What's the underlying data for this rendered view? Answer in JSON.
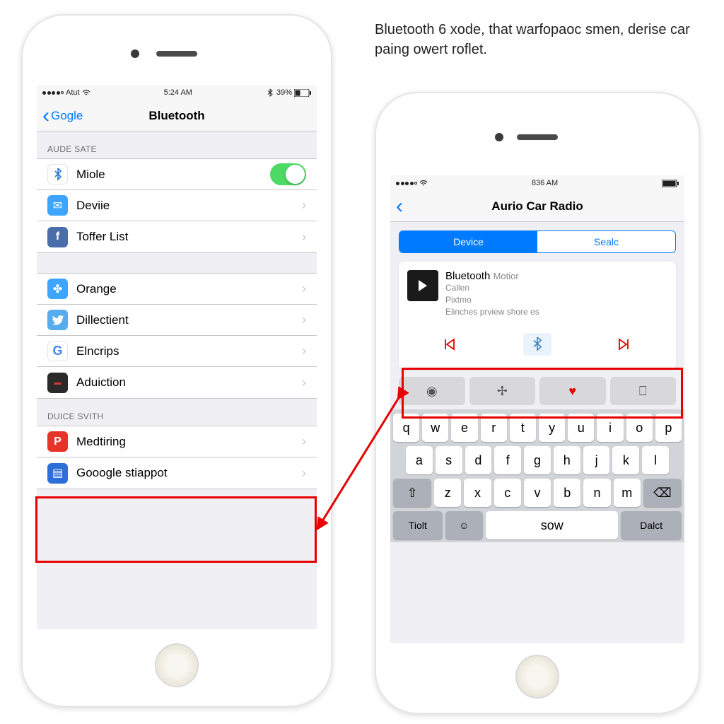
{
  "caption": "Bluetooth 6 xode, that warfopaoc smen, derise car paing owert roflet.",
  "phone_left": {
    "status": {
      "carrier": "Atut",
      "time": "5:24 AM",
      "battery_pct": "39%"
    },
    "nav": {
      "back": "Gogle",
      "title": "Bluetooth"
    },
    "section1_header": "AUDE SATE",
    "section1_items": [
      {
        "label": "Miole",
        "icon_name": "bluetooth-icon",
        "icon_bg": "#ffffff",
        "icon_color": "#2b7bd6",
        "toggle": true
      },
      {
        "label": "Deviie",
        "icon_name": "messages-icon",
        "icon_bg": "#3da5ff",
        "icon_color": "#fff"
      },
      {
        "label": "Toffer List",
        "icon_name": "social-icon",
        "icon_bg": "#4a6ea9",
        "icon_color": "#fff"
      }
    ],
    "section2_items": [
      {
        "label": "Orange",
        "icon_name": "flame-icon",
        "icon_bg": "#3da5ff",
        "icon_color": "#fff"
      },
      {
        "label": "Dillectient",
        "icon_name": "twitter-icon",
        "icon_bg": "#55acee",
        "icon_color": "#fff"
      },
      {
        "label": "Elncrips",
        "icon_name": "google-icon",
        "icon_bg": "#ffffff",
        "icon_color": "#333"
      },
      {
        "label": "Aduiction",
        "icon_name": "app-icon",
        "icon_bg": "#2a2a2a",
        "icon_color": "#d33"
      }
    ],
    "section3_header": "DUICE SVITH",
    "section3_items": [
      {
        "label": "Medtiring",
        "icon_name": "letter-p-icon",
        "icon_bg": "#e63429",
        "icon_color": "#fff"
      },
      {
        "label": "Gooogle stiappot",
        "icon_name": "car-icon",
        "icon_bg": "#2d6fd6",
        "icon_color": "#fff"
      }
    ]
  },
  "phone_right": {
    "status": {
      "time": "836 AM"
    },
    "nav": {
      "title": "Aurio Car Radio"
    },
    "segments": {
      "active": "Device",
      "inactive": "Sealc"
    },
    "card": {
      "title": "Bluetooth",
      "subtitle": "Motior",
      "line1": "Callen",
      "line2": "Pixtmo",
      "line3": "Elinches prview shore es"
    },
    "keyboard": {
      "row1": [
        "q",
        "w",
        "e",
        "r",
        "t",
        "y",
        "u",
        "i",
        "o",
        "p"
      ],
      "row2": [
        "a",
        "s",
        "d",
        "f",
        "g",
        "h",
        "j",
        "k",
        "l"
      ],
      "row3": [
        "z",
        "x",
        "c",
        "v",
        "b",
        "n",
        "m"
      ],
      "bottom": {
        "left": "Tiolt",
        "space": "sow",
        "right": "Dalct"
      }
    }
  }
}
